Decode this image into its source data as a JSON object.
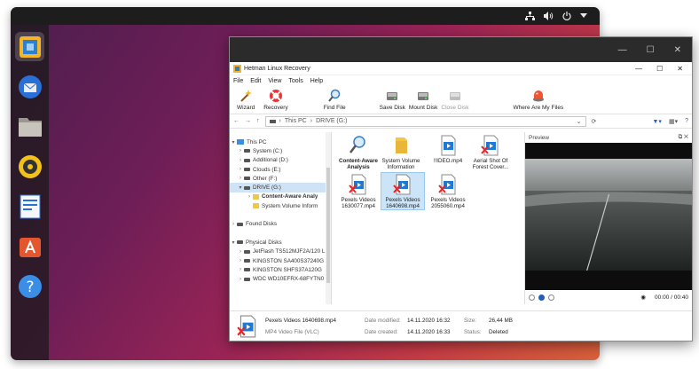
{
  "desktop": {
    "dock": [
      "hetman-app-icon",
      "thunderbird-icon",
      "files-icon",
      "rhythmbox-icon",
      "writer-icon",
      "software-center-icon",
      "help-icon"
    ]
  },
  "window_controls": {
    "minimize": "—",
    "maximize": "☐",
    "close": "✕"
  },
  "app": {
    "title": "Hetman Linux Recovery",
    "menu": [
      "File",
      "Edit",
      "View",
      "Tools",
      "Help"
    ],
    "toolbar": {
      "wizard": "Wizard",
      "recovery": "Recovery",
      "find_file": "Find File",
      "save_disk": "Save Disk",
      "mount_disk": "Mount Disk",
      "close_disk": "Close Disk",
      "where_are_my_files": "Where Are My Files"
    },
    "address": {
      "this_pc": "This PC",
      "drive": "DRIVE (G:)"
    },
    "tree": {
      "this_pc": "This PC",
      "drives": [
        "System (C:)",
        "Additional (D:)",
        "Clouds (E:)",
        "Other (F:)",
        "DRIVE (G:)"
      ],
      "drive_children": [
        "Content-Aware Analy",
        "System Volume Inform"
      ],
      "found_disks": "Found Disks",
      "physical_disks": "Physical Disks",
      "physical": [
        "JetFlash TS512MJF2A/120 L",
        "KINGSTON SA400S37240G",
        "KINGSTON SHFS37A120G",
        "WDC WD10EFRX-68FYTN0"
      ]
    },
    "files": [
      {
        "name": "Content-Aware Analysis"
      },
      {
        "name": "System Volume Information"
      },
      {
        "name": "!!IDEO.mp4"
      },
      {
        "name": "Aerial Shot Of Forest Cover..."
      },
      {
        "name": "Pexels Videos 1630077.mp4"
      },
      {
        "name": "Pexels Videos 1640698.mp4"
      },
      {
        "name": "Pexels Videos 2055060.mp4"
      }
    ],
    "preview": {
      "title": "Preview",
      "time": "00:00 / 00:40"
    },
    "details": {
      "filename": "Pexels Videos 1640698.mp4",
      "filetype": "MP4 Video File (VLC)",
      "date_modified_label": "Date modified:",
      "date_modified": "14.11.2020 16:32",
      "date_created_label": "Date created:",
      "date_created": "14.11.2020 16:33",
      "size_label": "Size:",
      "size": "26,44 MB",
      "status_label": "Status:",
      "status": "Deleted"
    }
  }
}
